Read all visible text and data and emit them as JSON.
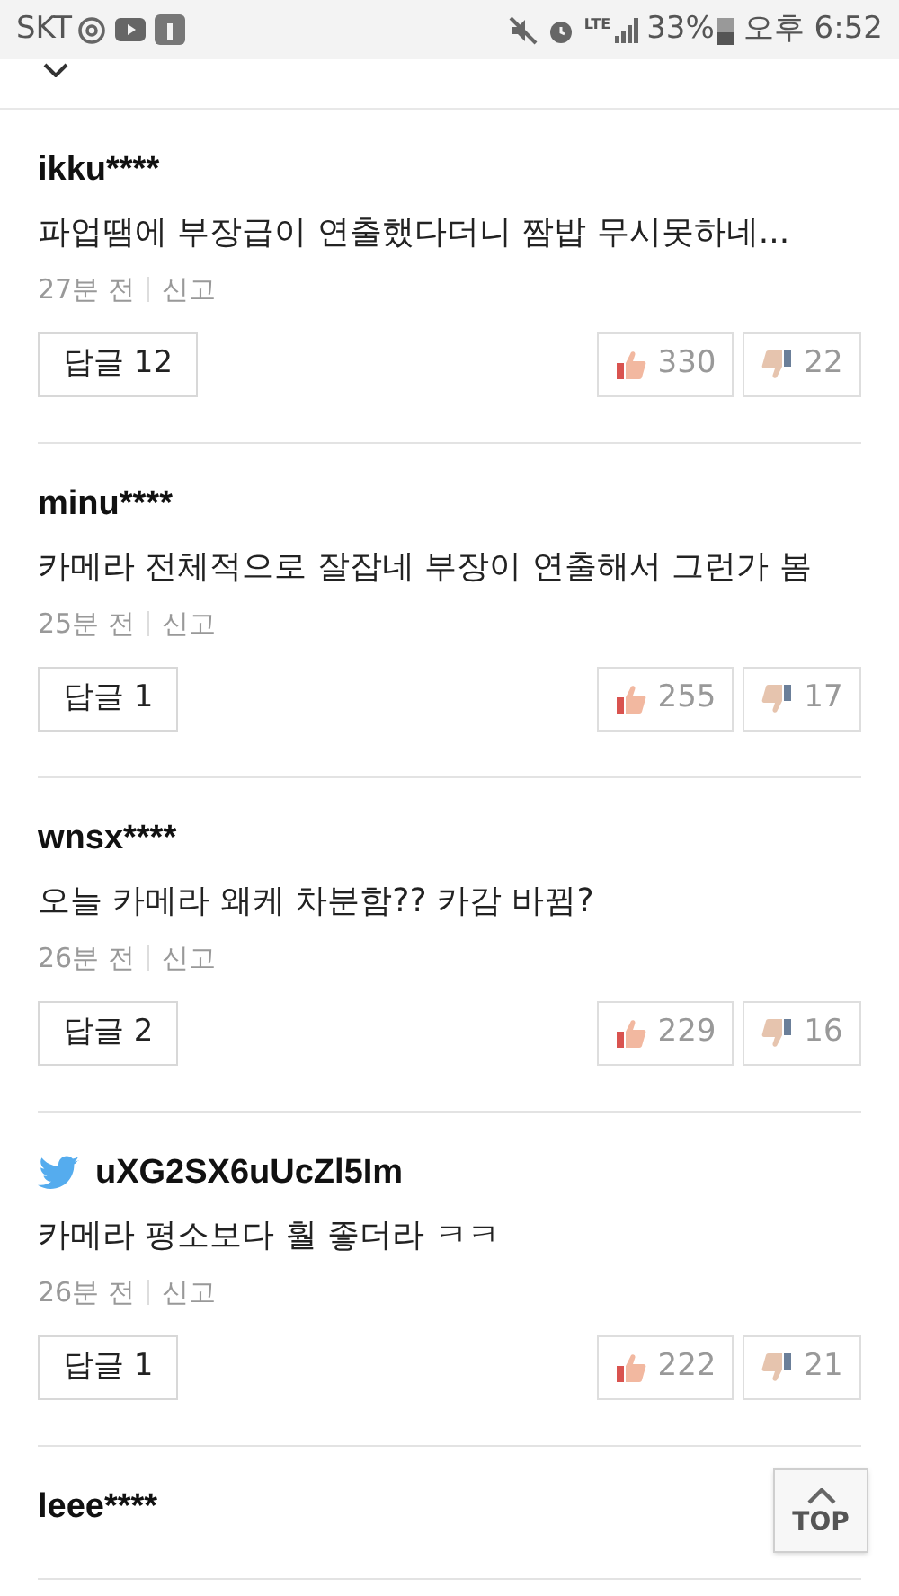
{
  "status_bar": {
    "carrier": "SKT",
    "network": "LTE",
    "battery": "33%",
    "time": "오후 6:52"
  },
  "comments": [
    {
      "kind": "member",
      "user": "ikku****",
      "text": "파업땜에 부장급이 연출했다더니 짬밥 무시못하네...",
      "time": "27분 전",
      "report": "신고",
      "replies": "답글 12",
      "likes": "330",
      "dislikes": "22"
    },
    {
      "kind": "member",
      "user": "minu****",
      "text": "카메라 전체적으로 잘잡네 부장이 연출해서 그런가 봄",
      "time": "25분 전",
      "report": "신고",
      "replies": "답글 1",
      "likes": "255",
      "dislikes": "17"
    },
    {
      "kind": "member",
      "user": "wnsx****",
      "text": "오늘 카메라 왜케 차분함?? 카감 바뀜?",
      "time": "26분 전",
      "report": "신고",
      "replies": "답글 2",
      "likes": "229",
      "dislikes": "16"
    },
    {
      "kind": "twitter",
      "user": "uXG2SX6uUcZl5Im",
      "text": "카메라 평소보다 훨 좋더라 ㅋㅋ",
      "time": "26분 전",
      "report": "신고",
      "replies": "답글 1",
      "likes": "222",
      "dislikes": "21"
    },
    {
      "kind": "member",
      "user": "leee****"
    }
  ],
  "top_button": {
    "label": "TOP"
  }
}
